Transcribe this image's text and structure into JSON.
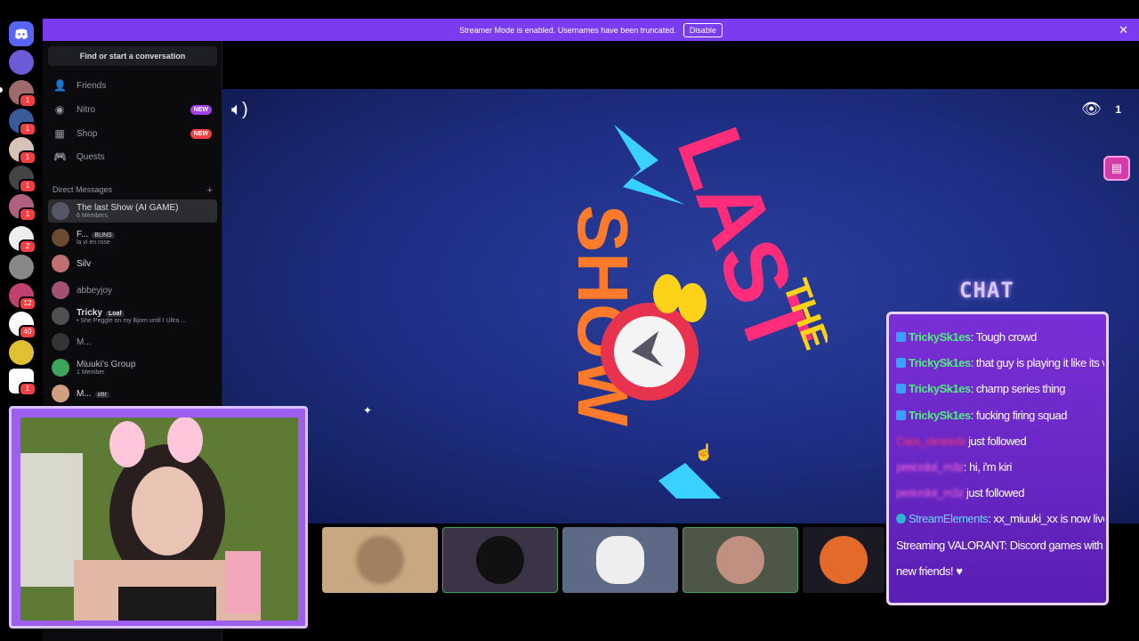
{
  "banner": {
    "message": "Streamer Mode is enabled. Usernames have been truncated.",
    "disable_label": "Disable"
  },
  "sidebar": {
    "search_placeholder": "Find or start a conversation",
    "nav": [
      {
        "label": "Friends",
        "icon": "friends-icon"
      },
      {
        "label": "Nitro",
        "icon": "nitro-icon",
        "badge": "NEW"
      },
      {
        "label": "Shop",
        "icon": "shop-icon",
        "badge": "NEW"
      },
      {
        "label": "Quests",
        "icon": "quests-icon"
      }
    ],
    "dm_header": "Direct Messages",
    "dms": [
      {
        "name": "The last Show (AI GAME)",
        "sub": "6 Members"
      },
      {
        "name": "F...",
        "tag": "BUNS",
        "sub": "la vi en rose"
      },
      {
        "name": "Silv",
        "sub": ""
      },
      {
        "name": "abbeyjoy",
        "sub": ""
      },
      {
        "name": "Tricky",
        "tag": "Loaf",
        "sub": "• She Peggle on my Bjorn until I Ultra ..."
      },
      {
        "name": "M...",
        "sub": ""
      },
      {
        "name": "Miuuki's Group",
        "sub": "1 Member"
      },
      {
        "name": "M...",
        "tag": "ottr",
        "sub": ""
      }
    ]
  },
  "rail": {
    "badges": [
      "1",
      "1",
      "1",
      "1",
      "1",
      "2",
      "12",
      "40",
      "1",
      "1"
    ]
  },
  "stream": {
    "viewer_count": "1",
    "logo_words": [
      "THE",
      "LAST",
      "SHOW"
    ]
  },
  "chat": {
    "title": "CHAT",
    "messages": [
      {
        "user": "TrickySk1es",
        "text": ": Tough crowd",
        "kind": "msg"
      },
      {
        "user": "TrickySk1es",
        "text": ": that guy is playing it like its vct",
        "kind": "msg"
      },
      {
        "user": "TrickySk1es",
        "text": ": champ series thing",
        "kind": "msg"
      },
      {
        "user": "TrickySk1es",
        "text": ": fucking firing squad",
        "kind": "msg"
      },
      {
        "user": "Cara_clearedx",
        "text": " just followed",
        "kind": "follow"
      },
      {
        "user": "pericrdot_m3z",
        "text": ": hi, i'm kiri",
        "kind": "follow2"
      },
      {
        "user": "pericrdot_m3z",
        "text": " just followed",
        "kind": "follow2"
      },
      {
        "user": "StreamElements",
        "text": ": xx_miuuki_xx is now live!",
        "kind": "se"
      },
      {
        "user": "",
        "text": "Streaming VALORANT: Discord games with",
        "kind": "plain"
      },
      {
        "user": "",
        "text": "new friends! ♥",
        "kind": "plain"
      }
    ]
  },
  "colors": {
    "banner": "#7b3cf0",
    "chat_user": "#4cf07a",
    "chat_box": "#7a2fd6",
    "stream_bg": "#1f2f86"
  }
}
